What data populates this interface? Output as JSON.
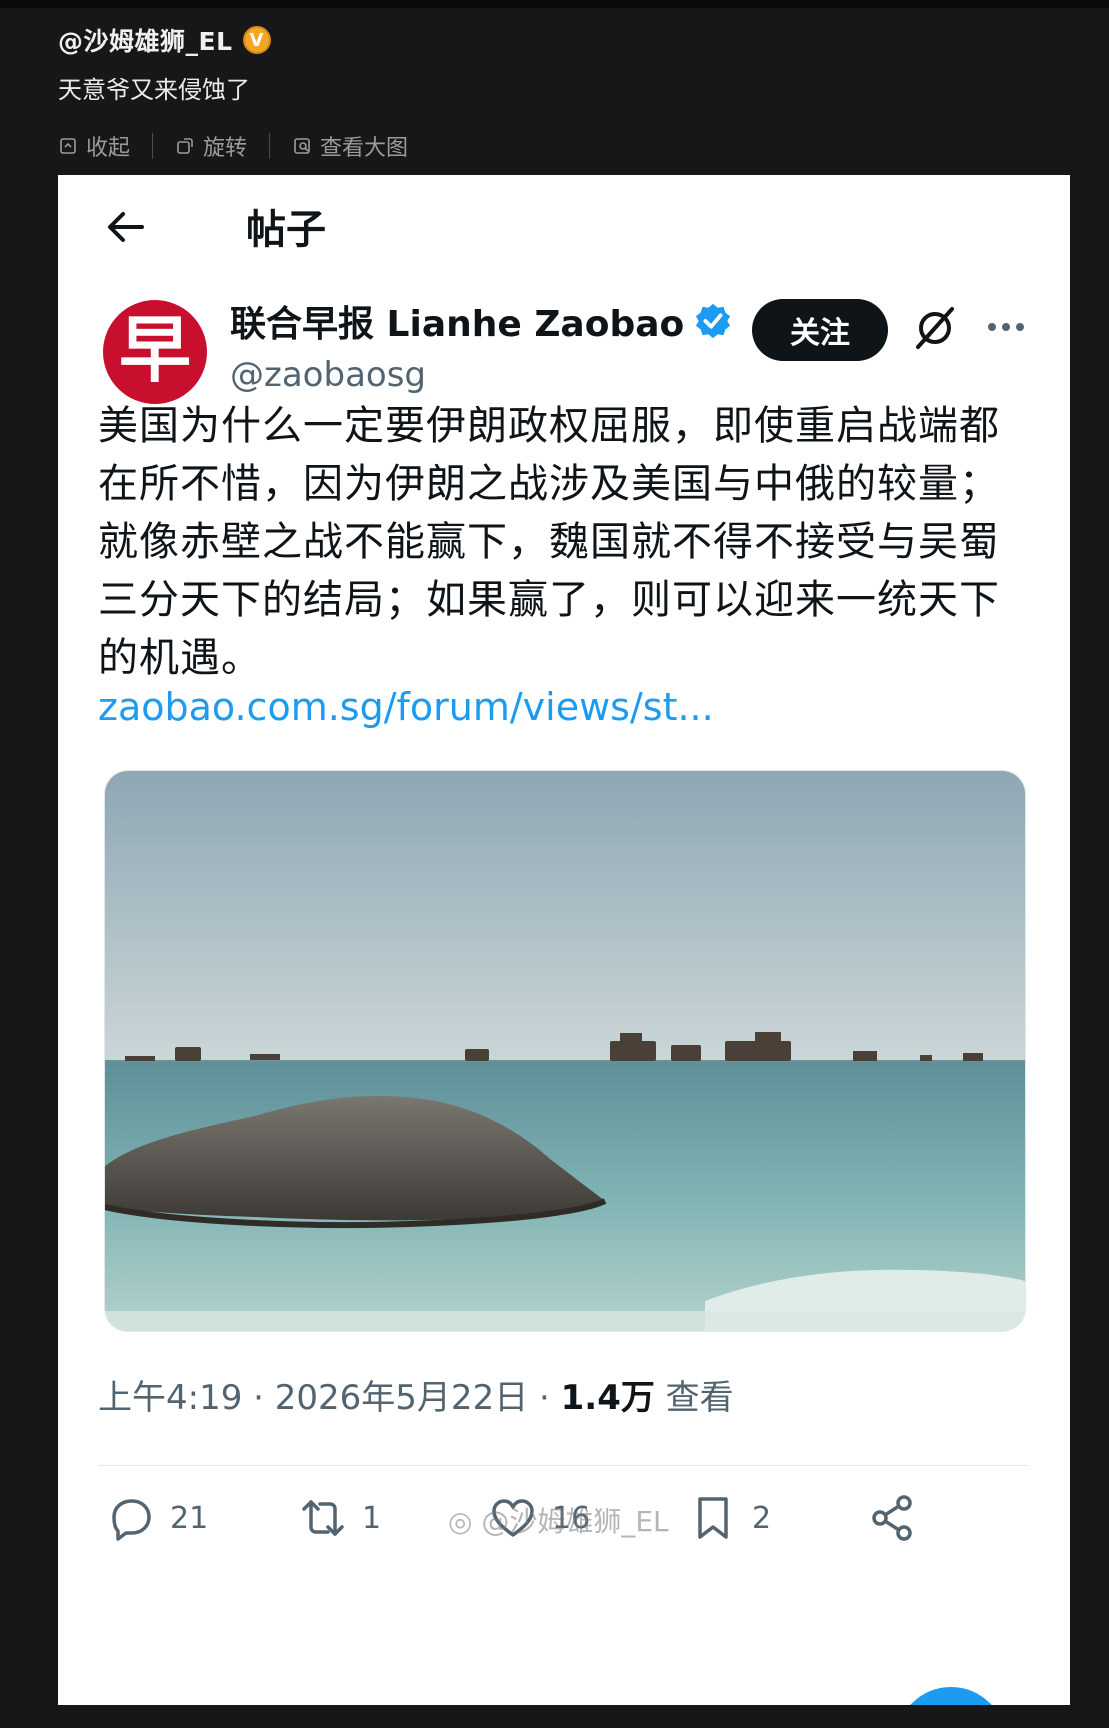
{
  "weibo": {
    "username": "@沙姆雄狮_EL",
    "badge": "V",
    "text": "天意爷又来侵蚀了",
    "actions": {
      "collapse": "收起",
      "rotate": "旋转",
      "view_large": "查看大图"
    }
  },
  "screenshot": {
    "header_title": "帖子",
    "account": {
      "name": "联合早报 Lianhe Zaobao",
      "handle": "@zaobaosg",
      "avatar_glyph": "早"
    },
    "follow_label": "关注",
    "post_text": "美国为什么一定要伊朗政权屈服，即使重启战端都在所不惜，因为伊朗之战涉及美国与中俄的较量；就像赤壁之战不能赢下，魏国就不得不接受与吴蜀三分天下的结局；如果赢了，则可以迎来一统天下的机遇。",
    "link_text": "zaobao.com.sg/forum/views/st...",
    "meta": {
      "time": "上午4:19 · 2026年5月22日 · ",
      "views": "1.4万",
      "views_label": " 查看"
    },
    "stats": {
      "replies": "21",
      "reposts": "1",
      "likes": "16",
      "bookmarks": "2"
    },
    "watermark": "@沙姆雄狮_EL"
  },
  "colors": {
    "page_bg": "#161718",
    "card_bg": "#ffffff",
    "accent_link": "#1d9bf0",
    "avatar_red": "#c8102e",
    "badge_orange": "#f5a623"
  },
  "icons": [
    "collapse-icon",
    "rotate-icon",
    "view-large-icon",
    "back-arrow-icon",
    "verified-icon",
    "grok-icon",
    "more-icon",
    "reply-icon",
    "repost-icon",
    "like-icon",
    "bookmark-icon",
    "share-icon",
    "weibo-logo-icon"
  ]
}
